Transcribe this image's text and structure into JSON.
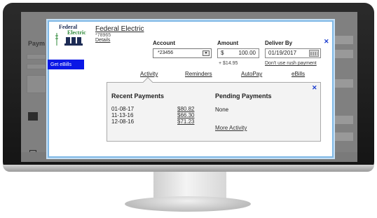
{
  "background_app": {
    "title": "Paym"
  },
  "logo": {
    "line1": "Federal",
    "line2": "Electric"
  },
  "biller": {
    "name": "Federal Electric",
    "account_mask": "*78965",
    "details_label": "Details"
  },
  "get_ebills_label": "Get eBills",
  "form": {
    "account_label": "Account",
    "account_value": "*23456",
    "amount_label": "Amount",
    "currency": "$",
    "amount_value": "100.00",
    "fee": "+ $14.95",
    "deliver_label": "Deliver By",
    "deliver_value": "01/19/2017",
    "rush_link": "Don't use rush payment"
  },
  "tabs": [
    {
      "label": "Activity"
    },
    {
      "label": "Reminders"
    },
    {
      "label": "AutoPay"
    },
    {
      "label": "eBills"
    }
  ],
  "activity": {
    "recent_heading": "Recent Payments",
    "pending_heading": "Pending Payments",
    "payments": [
      {
        "date": "01-08-17",
        "amount": "$80.82"
      },
      {
        "date": "11-13-16",
        "amount": "$66.30"
      },
      {
        "date": "12-08-16",
        "amount": "$71.23"
      }
    ],
    "pending_value": "None",
    "more_link": "More Activity"
  },
  "icons": {
    "close": "close-icon",
    "calendar": "calendar-icon",
    "dropdown": "chevron-down-icon"
  },
  "colors": {
    "ebills_button": "#0a17e6",
    "close_x": "#1a3ccf",
    "modal_border": "#7fb8e6",
    "logo_green": "#2f8a3a",
    "logo_navy": "#1d2c55"
  }
}
